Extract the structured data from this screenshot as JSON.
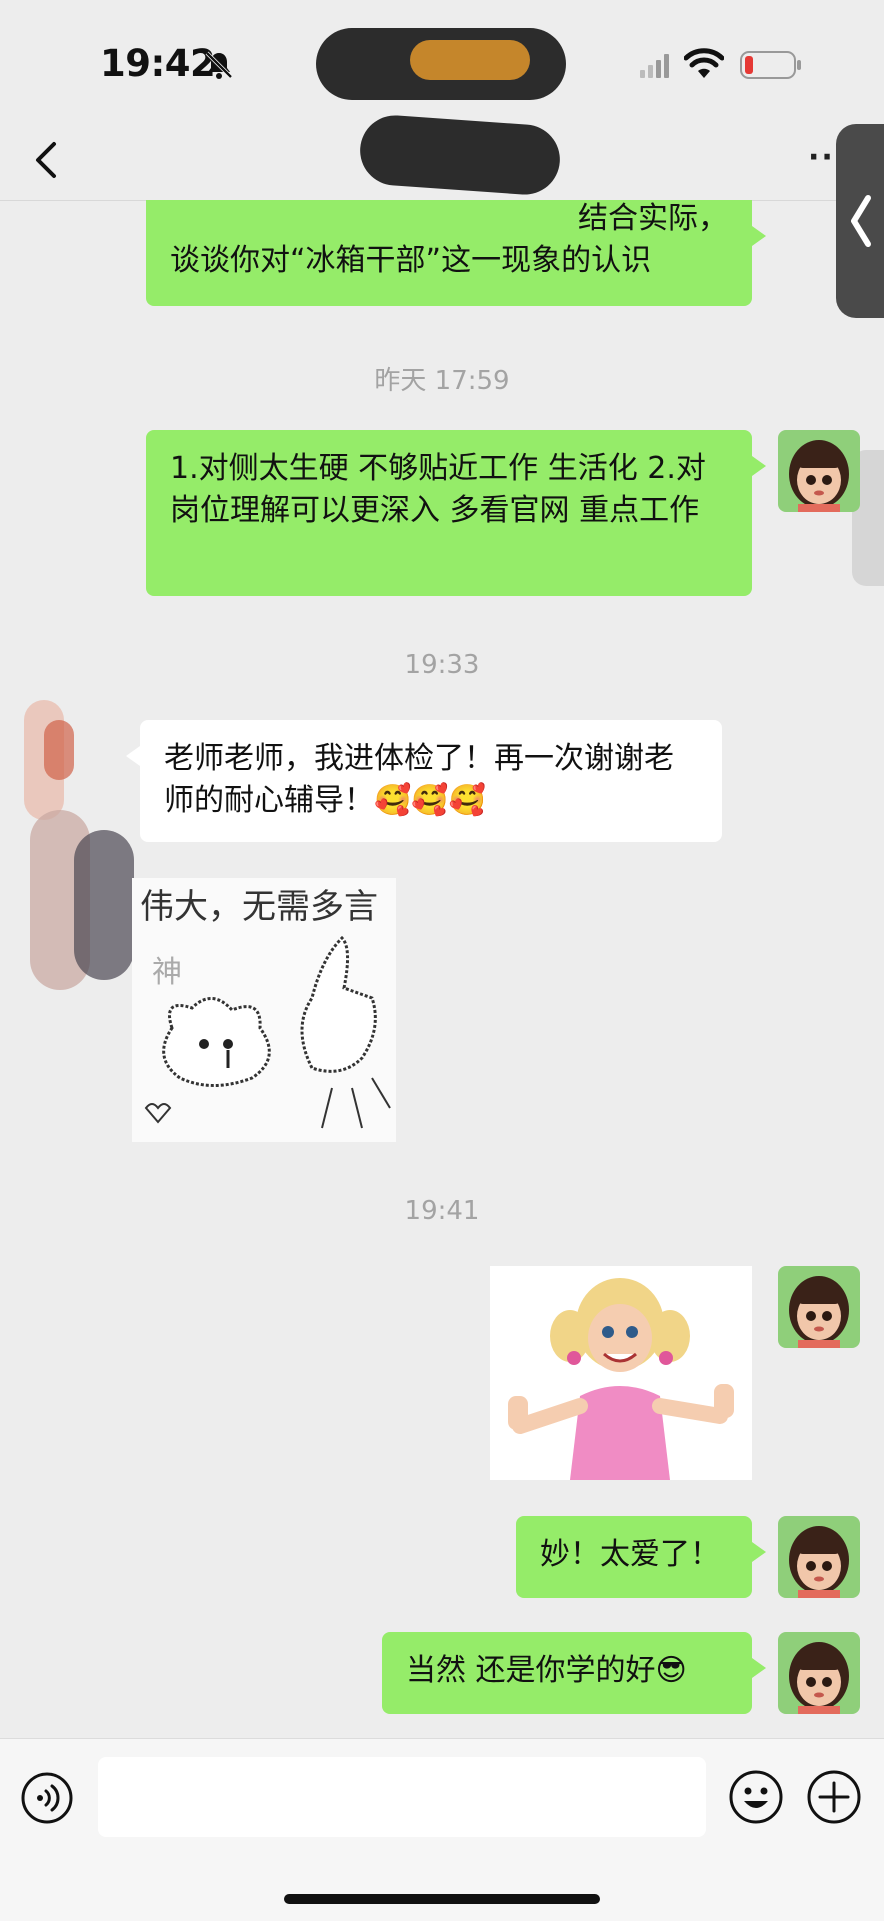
{
  "status": {
    "time": "19:42",
    "icons": [
      "bell-muted-icon",
      "cellular-signal-icon",
      "wifi-icon",
      "battery-low-icon"
    ]
  },
  "nav": {
    "back_icon": "chevron-left-icon",
    "more_label": "··"
  },
  "messages": {
    "partial_top": "谈谈你对“冰箱干部”这一现象的认识",
    "partial_top_line0": "结合实际，",
    "time1": "昨天 17:59",
    "msg1": "1.对侧太生硬 不够贴近工作 生活化 2.对岗位理解可以更深入 多看官网 重点工作",
    "time2": "19:33",
    "msg2": "老师老师，我进体检了！再一次谢谢老师的耐心辅导！🥰🥰🥰",
    "sticker1_text": "伟大，无需多言",
    "sticker1_text2": "神",
    "time3": "19:41",
    "msg3": "妙！太爱了！",
    "msg4": "当然 还是你学的好😎"
  },
  "input": {
    "placeholder": "",
    "icons": [
      "voice-icon",
      "emoji-icon",
      "plus-icon"
    ]
  },
  "colors": {
    "bubble_me": "#95ec69",
    "bubble_other": "#ffffff",
    "background": "#ededed",
    "battery_low": "#e53935"
  }
}
